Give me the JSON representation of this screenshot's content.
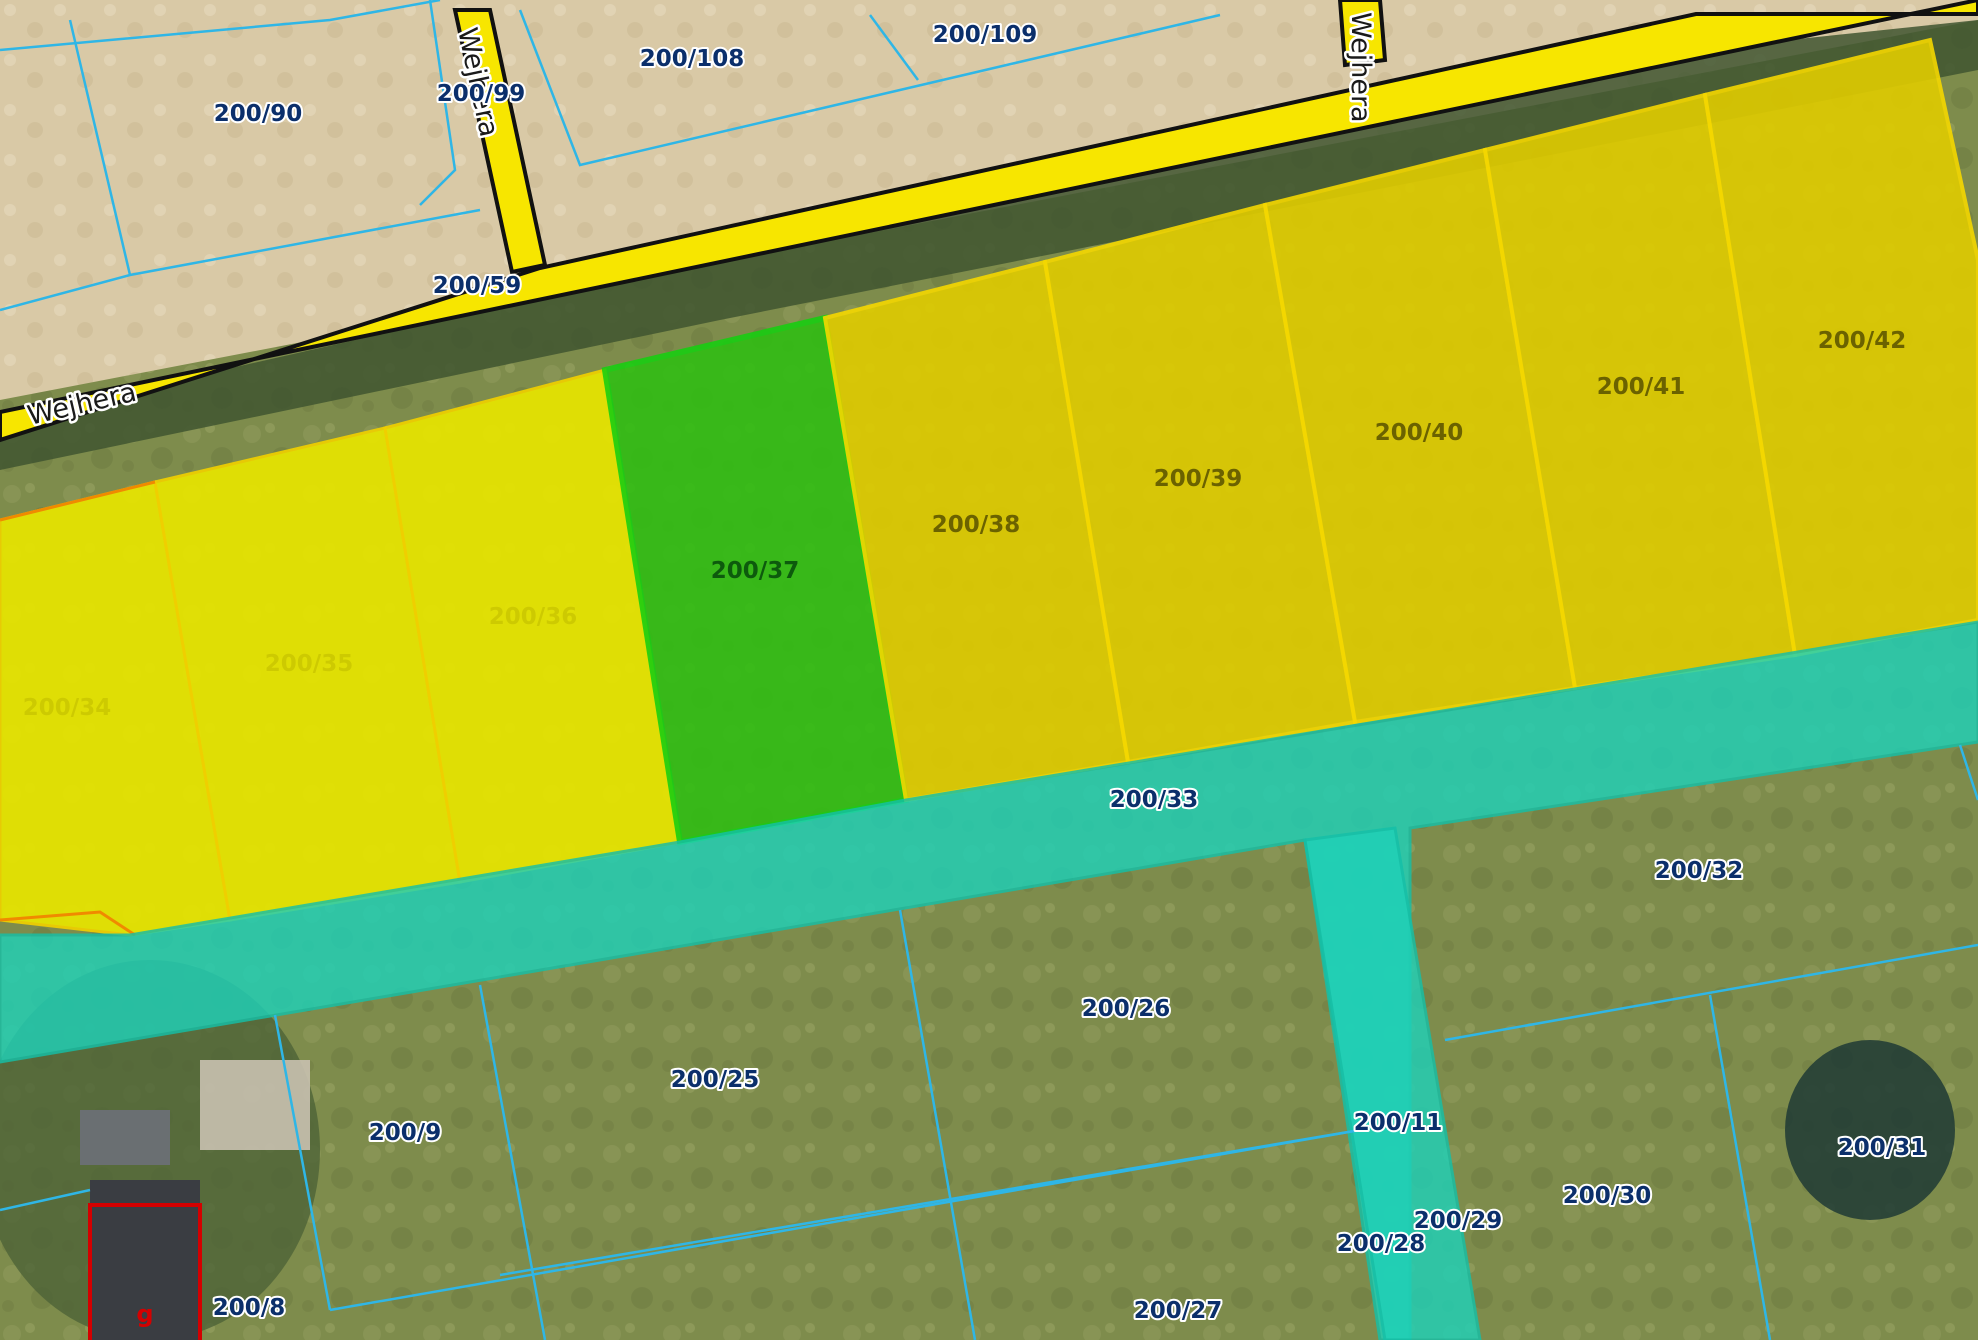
{
  "map": {
    "street_name": "Wejhera",
    "building_letter": "g",
    "parcels": [
      {
        "id": "p-200-109",
        "label": "200/109"
      },
      {
        "id": "p-200-108",
        "label": "200/108"
      },
      {
        "id": "p-200-99",
        "label": "200/99"
      },
      {
        "id": "p-200-90",
        "label": "200/90"
      },
      {
        "id": "p-200-59",
        "label": "200/59"
      },
      {
        "id": "p-200-34",
        "label": "200/34"
      },
      {
        "id": "p-200-35",
        "label": "200/35"
      },
      {
        "id": "p-200-36",
        "label": "200/36"
      },
      {
        "id": "p-200-37",
        "label": "200/37"
      },
      {
        "id": "p-200-38",
        "label": "200/38"
      },
      {
        "id": "p-200-39",
        "label": "200/39"
      },
      {
        "id": "p-200-40",
        "label": "200/40"
      },
      {
        "id": "p-200-41",
        "label": "200/41"
      },
      {
        "id": "p-200-42",
        "label": "200/42"
      },
      {
        "id": "p-200-33",
        "label": "200/33"
      },
      {
        "id": "p-200-32",
        "label": "200/32"
      },
      {
        "id": "p-200-26",
        "label": "200/26"
      },
      {
        "id": "p-200-25",
        "label": "200/25"
      },
      {
        "id": "p-200-9",
        "label": "200/9"
      },
      {
        "id": "p-200-11",
        "label": "200/11"
      },
      {
        "id": "p-200-29",
        "label": "200/29"
      },
      {
        "id": "p-200-28",
        "label": "200/28"
      },
      {
        "id": "p-200-30",
        "label": "200/30"
      },
      {
        "id": "p-200-31",
        "label": "200/31"
      },
      {
        "id": "p-200-8",
        "label": "200/8"
      },
      {
        "id": "p-200-27",
        "label": "200/27"
      }
    ]
  },
  "colors": {
    "selected_parcel": "#2fbf12",
    "highlight_parcels": "#e6d600",
    "road_parcel": "#1fd1b8",
    "parcel_border": "#2fb6e6",
    "street_fill": "#f7e600",
    "building_outline": "#d40000"
  }
}
